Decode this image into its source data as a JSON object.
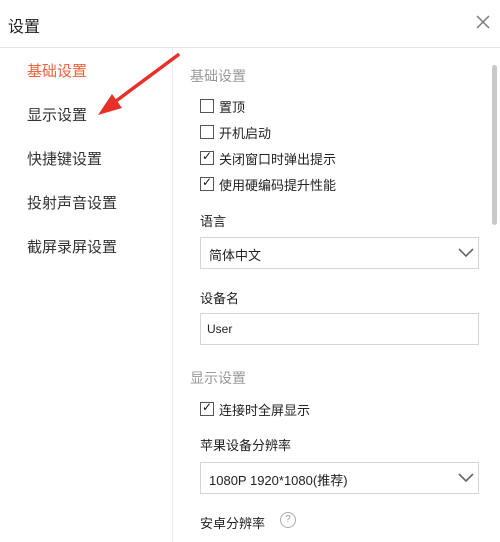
{
  "window": {
    "title": "设置"
  },
  "sidebar": {
    "items": [
      {
        "label": "基础设置",
        "active": true
      },
      {
        "label": "显示设置",
        "active": false
      },
      {
        "label": "快捷键设置",
        "active": false
      },
      {
        "label": "投射声音设置",
        "active": false
      },
      {
        "label": "截屏录屏设置",
        "active": false
      }
    ]
  },
  "basic": {
    "section_title": "基础设置",
    "options": [
      {
        "label": "置顶",
        "checked": false
      },
      {
        "label": "开机启动",
        "checked": false
      },
      {
        "label": "关闭窗口时弹出提示",
        "checked": true
      },
      {
        "label": "使用硬编码提升性能",
        "checked": true
      }
    ],
    "language_label": "语言",
    "language_value": "简体中文",
    "device_name_label": "设备名",
    "device_name_value": "User"
  },
  "display": {
    "section_title": "显示设置",
    "fullscreen_label": "连接时全屏显示",
    "fullscreen_checked": true,
    "apple_resolution_label": "苹果设备分辨率",
    "apple_resolution_value": "1080P 1920*1080(推荐)",
    "android_resolution_label": "安卓分辨率",
    "help_glyph": "?"
  },
  "colors": {
    "accent": "#f0623a",
    "arrow": "#e8302a"
  },
  "icons": {
    "close": "close-icon",
    "dropdown": "chevron-down-icon",
    "checkmark": "check-icon",
    "help": "help-icon"
  }
}
